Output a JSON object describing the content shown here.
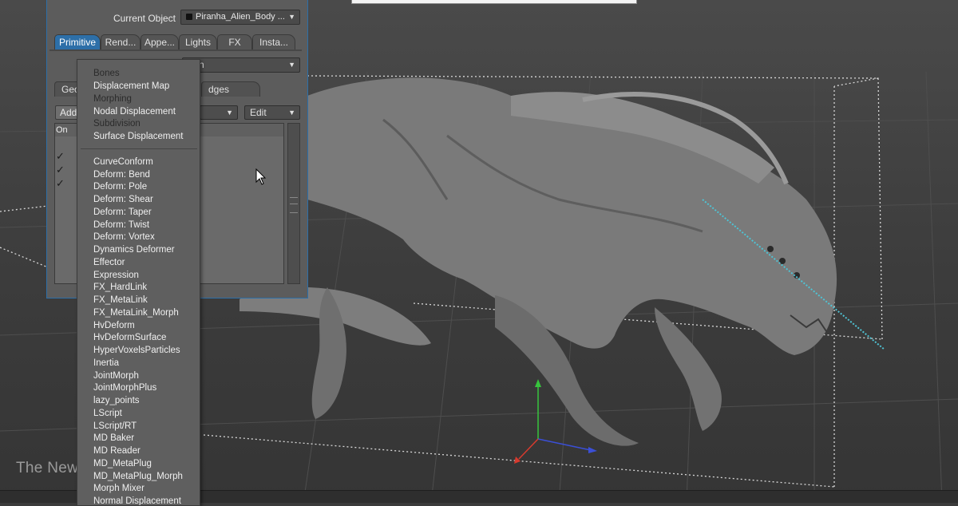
{
  "panel": {
    "current_object_label": "Current Object",
    "current_object_value": "Piranha_Alien_Body ...",
    "tabs": [
      {
        "label": "Primitive",
        "active": true
      },
      {
        "label": "Rend...",
        "active": false
      },
      {
        "label": "Appe...",
        "active": false
      },
      {
        "label": "Lights",
        "active": false
      },
      {
        "label": "FX",
        "active": false
      },
      {
        "label": "Insta...",
        "active": false
      }
    ],
    "dropdown_partial": "h",
    "subtabs": [
      "Geo",
      "dges"
    ],
    "add_label": "Add",
    "edit_label": "Edit",
    "list_header": "On",
    "checked_rows": 3,
    "accent_color": "#2d6fa8"
  },
  "menu": {
    "groups": [
      [
        "Bones",
        "Displacement Map",
        "Morphing",
        "Nodal Displacement",
        "Subdivision",
        "Surface Displacement"
      ],
      [
        "CurveConform",
        "Deform: Bend",
        "Deform: Pole",
        "Deform: Shear",
        "Deform: Taper",
        "Deform: Twist",
        "Deform: Vortex",
        "Dynamics Deformer",
        "Effector",
        "Expression",
        "FX_HardLink",
        "FX_MetaLink",
        "FX_MetaLink_Morph",
        "HvDeform",
        "HvDeformSurface",
        "HyperVoxelsParticles",
        "Inertia",
        "JointMorph",
        "JointMorphPlus",
        "lazy_points",
        "LScript",
        "LScript/RT",
        "MD Baker",
        "MD Reader",
        "MD_MetaPlug",
        "MD_MetaPlug_Morph",
        "Morph Mixer",
        "Normal Displacement"
      ]
    ],
    "heading_items": [
      "Bones",
      "Morphing",
      "Subdivision"
    ]
  },
  "viewport": {
    "watermark": "The New Modifier Stack",
    "icons": [
      "alien-model",
      "bounding-box",
      "transform-gizmo-icon",
      "cursor-icon"
    ]
  }
}
